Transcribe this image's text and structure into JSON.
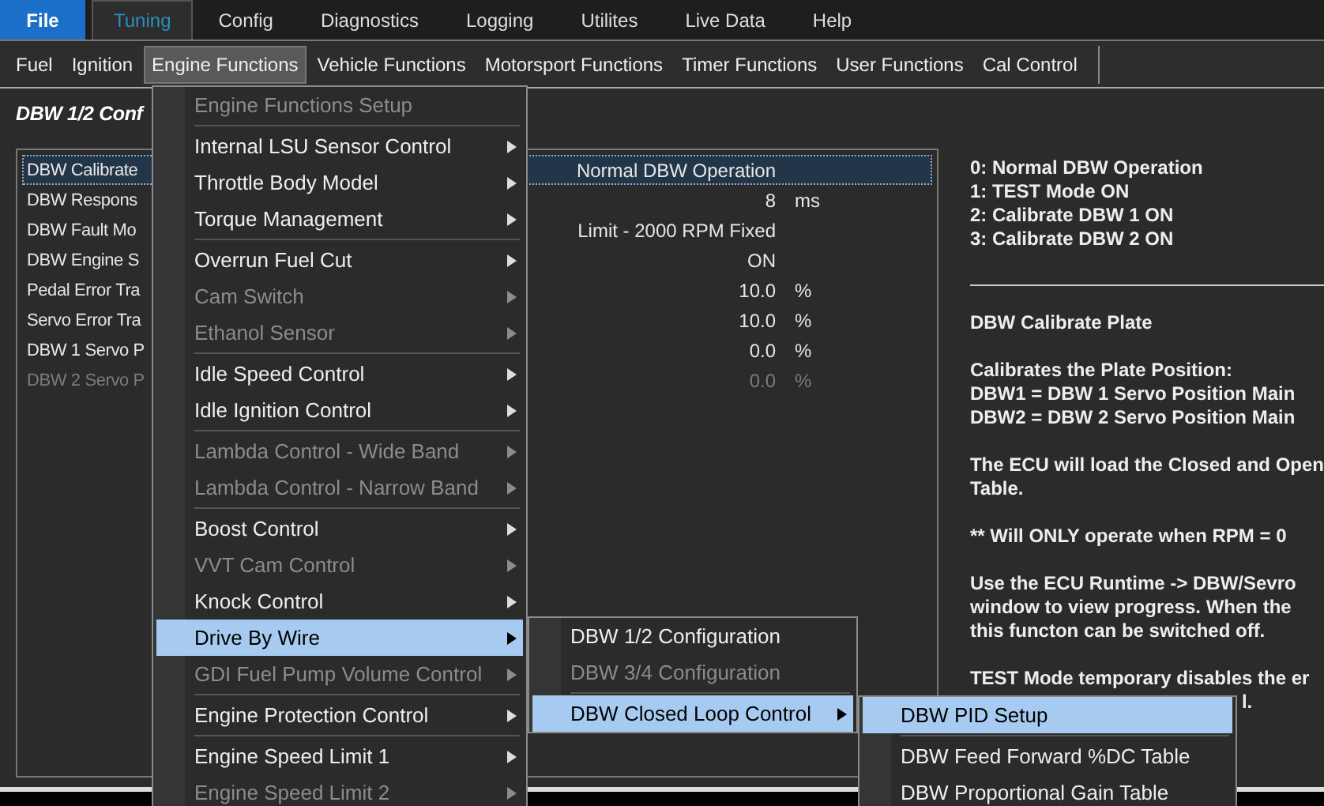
{
  "menubar": {
    "file_button": "File",
    "tabs": [
      {
        "label": "Tuning",
        "selected": true
      },
      {
        "label": "Config",
        "selected": false
      },
      {
        "label": "Diagnostics",
        "selected": false
      },
      {
        "label": "Logging",
        "selected": false
      },
      {
        "label": "Utilites",
        "selected": false
      },
      {
        "label": "Live Data",
        "selected": false
      },
      {
        "label": "Help",
        "selected": false
      }
    ]
  },
  "toolbar": [
    {
      "label": "Fuel",
      "selected": false
    },
    {
      "label": "Ignition",
      "selected": false
    },
    {
      "label": "Engine Functions",
      "selected": true
    },
    {
      "label": "Vehicle Functions",
      "selected": false
    },
    {
      "label": "Motorsport Functions",
      "selected": false
    },
    {
      "label": "Timer Functions",
      "selected": false
    },
    {
      "label": "User Functions",
      "selected": false
    },
    {
      "label": "Cal Control",
      "selected": false
    }
  ],
  "page_title": "DBW 1/2 Conf",
  "settings": [
    {
      "name": "DBW Calibrate",
      "value": "Normal DBW Operation",
      "selected": true,
      "disabled": false
    },
    {
      "name": "DBW Respons",
      "value": "8",
      "unit": "ms",
      "selected": false,
      "disabled": false
    },
    {
      "name": "DBW Fault Mo",
      "value": "Limit - 2000 RPM Fixed",
      "selected": false,
      "disabled": false
    },
    {
      "name": "DBW Engine S",
      "value": "ON",
      "selected": false,
      "disabled": false
    },
    {
      "name": "Pedal Error Tra",
      "value": "10.0",
      "unit": "%",
      "selected": false,
      "disabled": false
    },
    {
      "name": "Servo Error Tra",
      "value": "10.0",
      "unit": "%",
      "selected": false,
      "disabled": false
    },
    {
      "name": "DBW 1 Servo P",
      "value": "0.0",
      "unit": "%",
      "selected": false,
      "disabled": false
    },
    {
      "name": "DBW 2 Servo P",
      "value": "0.0",
      "unit": "%",
      "selected": false,
      "disabled": true
    }
  ],
  "help": [
    {
      "kind": "text",
      "lines": [
        "0: Normal DBW Operation",
        "1: TEST Mode ON",
        "2: Calibrate DBW 1 ON",
        "3: Calibrate DBW 2 ON"
      ]
    },
    {
      "kind": "rule"
    },
    {
      "kind": "text",
      "lines": [
        "DBW Calibrate Plate"
      ]
    },
    {
      "kind": "text",
      "lines": [
        "Calibrates the Plate Position:",
        "DBW1 =  DBW 1 Servo Position Main",
        "DBW2 =  DBW 2 Servo Position Main"
      ]
    },
    {
      "kind": "text",
      "lines": [
        "The ECU will load the Closed and Open",
        "Table."
      ]
    },
    {
      "kind": "text",
      "lines": [
        "** Will ONLY operate when RPM = 0"
      ]
    },
    {
      "kind": "text",
      "lines": [
        "Use the ECU Runtime -> DBW/Sevro",
        "window to view progress. When the",
        " this functon can be switched off."
      ]
    },
    {
      "kind": "text",
      "lines": [
        "TEST Mode temporary disables the er"
      ]
    },
    {
      "kind": "tail",
      "lines": [
        "l."
      ]
    }
  ],
  "menus": [
    {
      "items": [
        {
          "kind": "item",
          "label": "Engine Functions Setup",
          "disabled": true,
          "submenu": false,
          "selected": false
        },
        {
          "kind": "separator"
        },
        {
          "kind": "item",
          "label": "Internal LSU Sensor Control",
          "disabled": false,
          "submenu": true,
          "selected": false
        },
        {
          "kind": "item",
          "label": "Throttle Body Model",
          "disabled": false,
          "submenu": true,
          "selected": false
        },
        {
          "kind": "item",
          "label": "Torque Management",
          "disabled": false,
          "submenu": true,
          "selected": false
        },
        {
          "kind": "separator"
        },
        {
          "kind": "item",
          "label": "Overrun Fuel Cut",
          "disabled": false,
          "submenu": true,
          "selected": false
        },
        {
          "kind": "item",
          "label": "Cam Switch",
          "disabled": true,
          "submenu": true,
          "selected": false
        },
        {
          "kind": "item",
          "label": "Ethanol Sensor",
          "disabled": true,
          "submenu": true,
          "selected": false
        },
        {
          "kind": "separator"
        },
        {
          "kind": "item",
          "label": "Idle Speed Control",
          "disabled": false,
          "submenu": true,
          "selected": false
        },
        {
          "kind": "item",
          "label": "Idle Ignition Control",
          "disabled": false,
          "submenu": true,
          "selected": false
        },
        {
          "kind": "separator"
        },
        {
          "kind": "item",
          "label": "Lambda Control - Wide Band",
          "disabled": true,
          "submenu": true,
          "selected": false
        },
        {
          "kind": "item",
          "label": "Lambda Control - Narrow Band",
          "disabled": true,
          "submenu": true,
          "selected": false
        },
        {
          "kind": "separator"
        },
        {
          "kind": "item",
          "label": "Boost Control",
          "disabled": false,
          "submenu": true,
          "selected": false
        },
        {
          "kind": "item",
          "label": "VVT Cam Control",
          "disabled": true,
          "submenu": true,
          "selected": false
        },
        {
          "kind": "item",
          "label": "Knock Control",
          "disabled": false,
          "submenu": true,
          "selected": false
        },
        {
          "kind": "item",
          "label": "Drive By Wire",
          "disabled": false,
          "submenu": true,
          "selected": true
        },
        {
          "kind": "item",
          "label": "GDI Fuel Pump Volume Control",
          "disabled": true,
          "submenu": true,
          "selected": false
        },
        {
          "kind": "separator"
        },
        {
          "kind": "item",
          "label": "Engine Protection Control",
          "disabled": false,
          "submenu": true,
          "selected": false
        },
        {
          "kind": "separator"
        },
        {
          "kind": "item",
          "label": "Engine Speed Limit 1",
          "disabled": false,
          "submenu": true,
          "selected": false
        },
        {
          "kind": "item",
          "label": "Engine Speed Limit 2",
          "disabled": true,
          "submenu": true,
          "selected": false
        }
      ]
    },
    {
      "items": [
        {
          "kind": "item",
          "label": "DBW 1/2 Configuration",
          "disabled": false,
          "submenu": false,
          "selected": false
        },
        {
          "kind": "item",
          "label": "DBW 3/4 Configuration",
          "disabled": true,
          "submenu": false,
          "selected": false
        },
        {
          "kind": "separator"
        },
        {
          "kind": "item",
          "label": "DBW Closed Loop Control",
          "disabled": false,
          "submenu": true,
          "selected": true
        }
      ]
    },
    {
      "items": [
        {
          "kind": "item",
          "label": "DBW PID Setup",
          "disabled": false,
          "submenu": false,
          "selected": true
        },
        {
          "kind": "separator"
        },
        {
          "kind": "item",
          "label": "DBW Feed Forward %DC Table",
          "disabled": false,
          "submenu": false,
          "selected": false
        },
        {
          "kind": "item",
          "label": "DBW Proportional Gain Table",
          "disabled": false,
          "submenu": false,
          "selected": false
        }
      ]
    }
  ]
}
